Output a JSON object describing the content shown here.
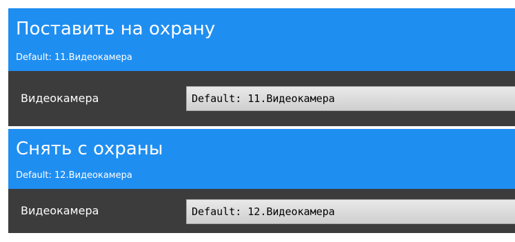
{
  "sections": [
    {
      "title": "Поставить на охрану",
      "subtitle": "Default: 11.Видеокамера",
      "field_label": "Видеокамера",
      "field_value": "Default: 11.Видеокамера"
    },
    {
      "title": "Снять с охраны",
      "subtitle": "Default: 12.Видеокамера",
      "field_label": "Видеокамера",
      "field_value": "Default: 12.Видеокамера"
    }
  ],
  "colors": {
    "header_bg": "#1f8ef1",
    "row_bg": "#3c3c3c",
    "field_bg": "#dcdcdc"
  }
}
